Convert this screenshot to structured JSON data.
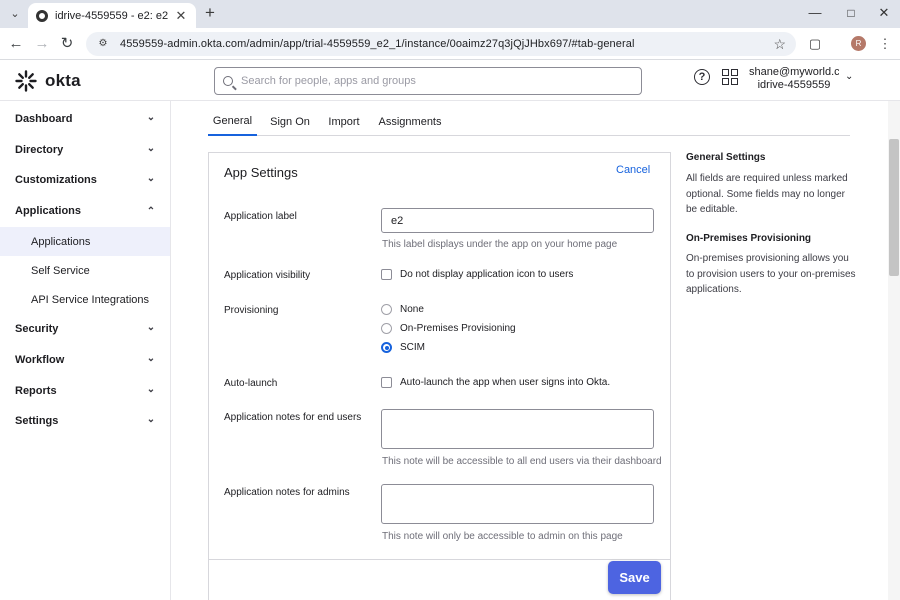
{
  "browser": {
    "tab_title": "idrive-4559559 - e2: e2",
    "url": "4559559-admin.okta.com/admin/app/trial-4559559_e2_1/instance/0oaimz27q3jQjJHbx697/#tab-general",
    "profile_initial": "R"
  },
  "header": {
    "logo_text": "okta",
    "search_placeholder": "Search for people, apps and groups",
    "user_email": "shane@myworld.c...",
    "org_name": "idrive-4559559"
  },
  "sidebar": {
    "items": [
      {
        "label": "Dashboard",
        "expanded": false
      },
      {
        "label": "Directory",
        "expanded": false
      },
      {
        "label": "Customizations",
        "expanded": false
      },
      {
        "label": "Applications",
        "expanded": true
      },
      {
        "label": "Security",
        "expanded": false
      },
      {
        "label": "Workflow",
        "expanded": false
      },
      {
        "label": "Reports",
        "expanded": false
      },
      {
        "label": "Settings",
        "expanded": false
      }
    ],
    "sub_items": [
      {
        "label": "Applications",
        "active": true
      },
      {
        "label": "Self Service",
        "active": false
      },
      {
        "label": "API Service Integrations",
        "active": false
      }
    ]
  },
  "tabs": [
    {
      "label": "General",
      "active": true
    },
    {
      "label": "Sign On",
      "active": false
    },
    {
      "label": "Import",
      "active": false
    },
    {
      "label": "Assignments",
      "active": false
    }
  ],
  "settings": {
    "title": "App Settings",
    "cancel_label": "Cancel",
    "app_label": {
      "label": "Application label",
      "value": "e2",
      "help": "This label displays under the app on your home page"
    },
    "visibility": {
      "label": "Application visibility",
      "option": "Do not display application icon to users",
      "checked": false
    },
    "provisioning": {
      "label": "Provisioning",
      "options": [
        "None",
        "On-Premises Provisioning",
        "SCIM"
      ],
      "selected": "SCIM"
    },
    "auto_launch": {
      "label": "Auto-launch",
      "option": "Auto-launch the app when user signs into Okta.",
      "checked": false
    },
    "notes_end_users": {
      "label": "Application notes for end users",
      "value": "",
      "help": "This note will be accessible to all end users via their dashboard"
    },
    "notes_admins": {
      "label": "Application notes for admins",
      "value": "",
      "help": "This note will only be accessible to admin on this page"
    },
    "save_label": "Save"
  },
  "info": {
    "general_title": "General Settings",
    "general_text": "All fields are required unless marked optional. Some fields may no longer be editable.",
    "onprem_title": "On-Premises Provisioning",
    "onprem_text": "On-premises provisioning allows you to provision users to your on-premises applications."
  },
  "colors": {
    "accent": "#1662dd",
    "save_button": "#4d64e1",
    "active_nav_bg": "#eef0fb"
  }
}
